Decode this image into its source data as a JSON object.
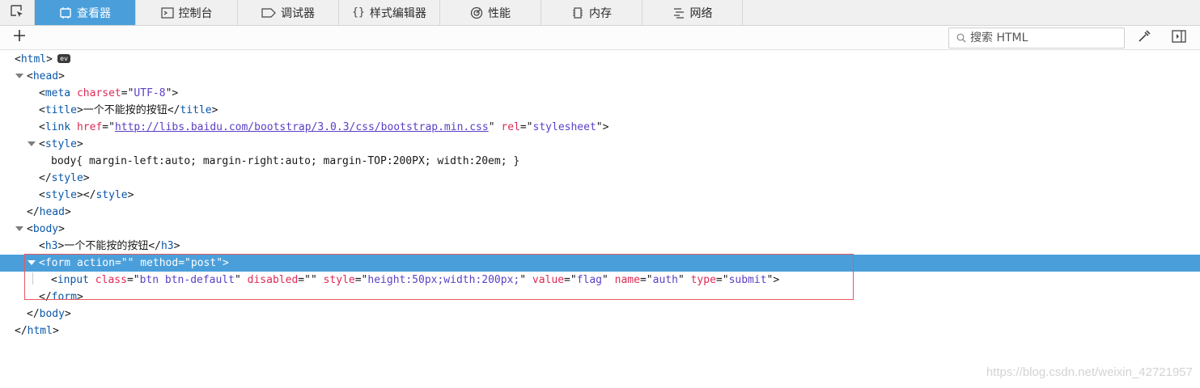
{
  "tabs": [
    {
      "label": "查看器",
      "icon": "inspector-icon",
      "active": true
    },
    {
      "label": "控制台",
      "icon": "console-icon",
      "active": false
    },
    {
      "label": "调试器",
      "icon": "debugger-icon",
      "active": false
    },
    {
      "label": "样式编辑器",
      "icon": "style-editor-icon",
      "active": false
    },
    {
      "label": "性能",
      "icon": "performance-icon",
      "active": false
    },
    {
      "label": "内存",
      "icon": "memory-icon",
      "active": false
    },
    {
      "label": "网络",
      "icon": "network-icon",
      "active": false
    }
  ],
  "toolbar": {
    "search_placeholder": "搜索 HTML"
  },
  "colors": {
    "accent": "#4a9fdb",
    "tag": "#0a57a8",
    "attr_name": "#dd2a55",
    "attr_value": "#5b3fc5",
    "highlight_box": "#e8585f"
  },
  "markup": {
    "html_open": {
      "tag": "html",
      "badge": "ev"
    },
    "head_open": {
      "tag": "head"
    },
    "meta": {
      "tag": "meta",
      "attr": "charset",
      "val": "UTF-8"
    },
    "title": {
      "tag": "title",
      "text": "一个不能按的按钮"
    },
    "link": {
      "tag": "link",
      "a1": "href",
      "v1": "http://libs.baidu.com/bootstrap/3.0.3/css/bootstrap.min.css",
      "a2": "rel",
      "v2": "stylesheet"
    },
    "style_open": {
      "tag": "style"
    },
    "style_text": "body{ margin-left:auto; margin-right:auto; margin-TOP:200PX; width:20em; }",
    "style_close": {
      "tag": "style"
    },
    "style_empty": {
      "tag": "style"
    },
    "head_close": {
      "tag": "head"
    },
    "body_open": {
      "tag": "body"
    },
    "h3": {
      "tag": "h3",
      "text": "一个不能按的按钮"
    },
    "form": {
      "tag": "form",
      "a1": "action",
      "v1": "",
      "a2": "method",
      "v2": "post"
    },
    "input": {
      "tag": "input",
      "attrs": [
        {
          "name": "class",
          "value": "btn btn-default"
        },
        {
          "name": "disabled",
          "value": ""
        },
        {
          "name": "style",
          "value": "height:50px;width:200px;"
        },
        {
          "name": "value",
          "value": "flag"
        },
        {
          "name": "name",
          "value": "auth"
        },
        {
          "name": "type",
          "value": "submit"
        }
      ]
    },
    "form_close": {
      "tag": "form"
    },
    "body_close": {
      "tag": "body"
    },
    "html_close": {
      "tag": "html"
    }
  },
  "watermark": "https://blog.csdn.net/weixin_42721957"
}
